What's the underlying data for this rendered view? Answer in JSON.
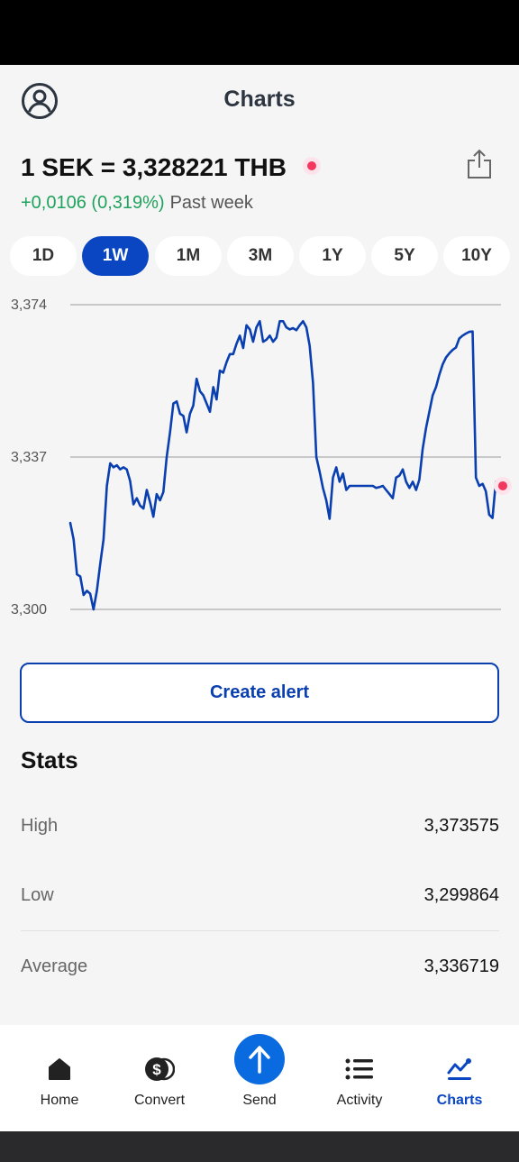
{
  "header": {
    "title": "Charts"
  },
  "rate": {
    "text": "1 SEK = 3,328221 THB"
  },
  "change": {
    "value": "+0,0106 (0,319%)",
    "period": "Past week"
  },
  "tabs": [
    {
      "label": "1D",
      "active": false
    },
    {
      "label": "1W",
      "active": true
    },
    {
      "label": "1M",
      "active": false
    },
    {
      "label": "3M",
      "active": false
    },
    {
      "label": "1Y",
      "active": false
    },
    {
      "label": "5Y",
      "active": false
    },
    {
      "label": "10Y",
      "active": false
    }
  ],
  "chart_data": {
    "type": "line",
    "title": "",
    "xlabel": "",
    "ylabel": "",
    "y_ticks": [
      "3,374",
      "3,337",
      "3,300"
    ],
    "ylim": [
      3.3,
      3.374
    ],
    "grid": true,
    "series": [
      {
        "color": "#0a3fb0",
        "values": [
          3.321,
          3.317,
          3.3085,
          3.308,
          3.3035,
          3.3045,
          3.3038,
          3.3,
          3.3045,
          3.311,
          3.317,
          3.33,
          3.3355,
          3.3345,
          3.335,
          3.334,
          3.3345,
          3.334,
          3.3312,
          3.3255,
          3.327,
          3.3252,
          3.3245,
          3.329,
          3.326,
          3.3225,
          3.328,
          3.3265,
          3.3285,
          3.337,
          3.343,
          3.35,
          3.3505,
          3.3475,
          3.347,
          3.343,
          3.3475,
          3.3495,
          3.356,
          3.353,
          3.352,
          3.35,
          3.348,
          3.354,
          3.351,
          3.358,
          3.3575,
          3.36,
          3.362,
          3.362,
          3.3645,
          3.3665,
          3.3635,
          3.369,
          3.368,
          3.365,
          3.3685,
          3.37,
          3.365,
          3.3655,
          3.3665,
          3.365,
          3.366,
          3.37,
          3.37,
          3.3685,
          3.368,
          3.3683,
          3.3678,
          3.369,
          3.37,
          3.3685,
          3.364,
          3.355,
          3.337,
          3.3335,
          3.3295,
          3.3265,
          3.322,
          3.332,
          3.3345,
          3.331,
          3.333,
          3.329,
          3.33,
          3.33,
          3.33,
          3.33,
          3.33,
          3.33,
          3.33,
          3.33,
          3.3295,
          3.3297,
          3.33,
          3.329,
          3.328,
          3.327,
          3.332,
          3.3325,
          3.334,
          3.331,
          3.3295,
          3.331,
          3.329,
          3.3315,
          3.339,
          3.344,
          3.348,
          3.352,
          3.354,
          3.357,
          3.3595,
          3.3612,
          3.3622,
          3.363,
          3.3636,
          3.3658,
          3.3665,
          3.367,
          3.3674,
          3.3675,
          3.332,
          3.33,
          3.3305,
          3.3287,
          3.323,
          3.3222,
          3.331,
          3.33
        ]
      }
    ]
  },
  "actions": {
    "create_alert": "Create alert"
  },
  "stats": {
    "title": "Stats",
    "rows": [
      {
        "label": "High",
        "value": "3,373575"
      },
      {
        "label": "Low",
        "value": "3,299864"
      },
      {
        "label": "Average",
        "value": "3,336719"
      }
    ]
  },
  "nav": [
    {
      "label": "Home",
      "icon": "home-icon"
    },
    {
      "label": "Convert",
      "icon": "dollar-coin-icon"
    },
    {
      "label": "Send",
      "icon": "arrow-up-icon"
    },
    {
      "label": "Activity",
      "icon": "list-icon"
    },
    {
      "label": "Charts",
      "icon": "chart-icon",
      "active": true
    }
  ]
}
